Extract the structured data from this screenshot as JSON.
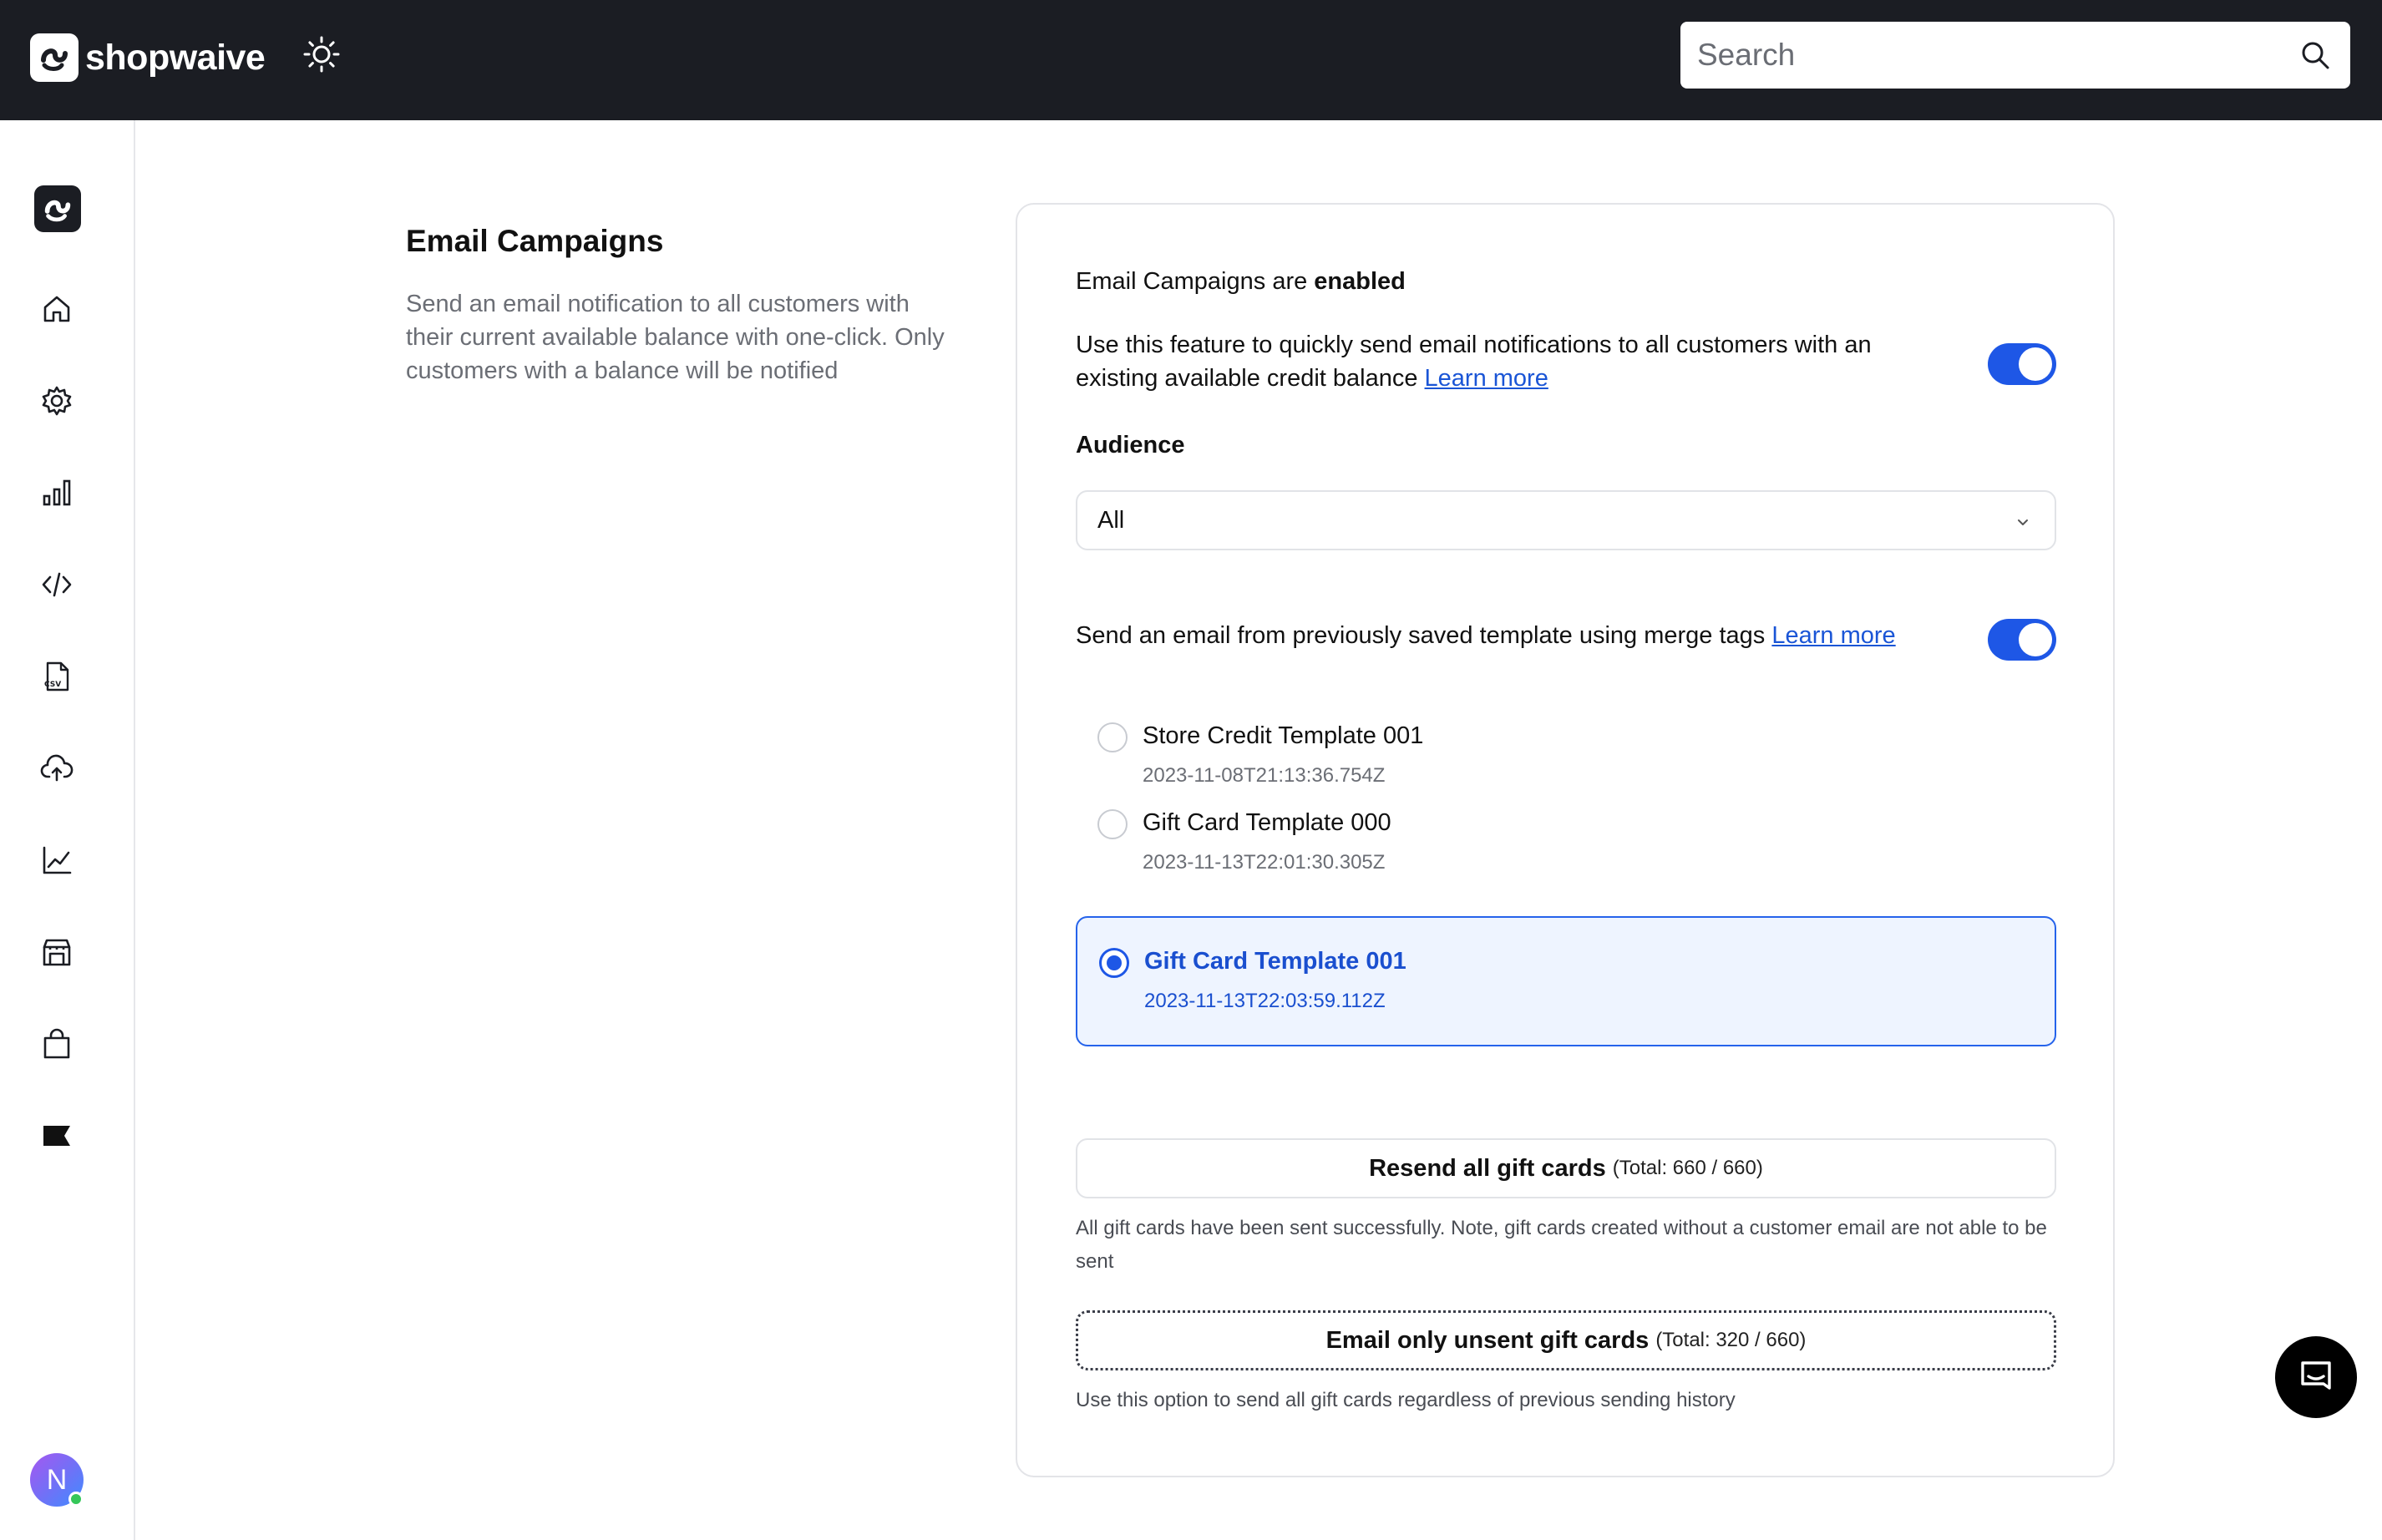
{
  "header": {
    "brand_name": "shopwaive",
    "search_placeholder": "Search"
  },
  "sidebar": {
    "items": [
      {
        "name": "home-icon"
      },
      {
        "name": "gear-icon"
      },
      {
        "name": "bar-chart-icon"
      },
      {
        "name": "code-icon"
      },
      {
        "name": "csv-file-icon"
      },
      {
        "name": "cloud-upload-icon"
      },
      {
        "name": "trend-chart-icon"
      },
      {
        "name": "storefront-icon"
      },
      {
        "name": "shopping-bag-icon"
      },
      {
        "name": "flag-icon"
      }
    ],
    "avatar_initial": "N"
  },
  "section": {
    "title": "Email Campaigns",
    "description": "Send an email notification to all customers with their current available balance with one-click. Only customers with a balance will be notified"
  },
  "card": {
    "status_prefix": "Email Campaigns are ",
    "status_value": "enabled",
    "feature_text": "Use this feature to quickly send email notifications to all customers with an existing available credit balance ",
    "feature_link": "Learn more",
    "feature_enabled": true,
    "audience_label": "Audience",
    "audience_value": "All",
    "template_text": "Send an email from previously saved template using merge tags ",
    "template_link": "Learn more",
    "template_enabled": true,
    "templates": [
      {
        "name": "Store Credit Template 001",
        "date": "2023-11-08T21:13:36.754Z",
        "selected": false
      },
      {
        "name": "Gift Card Template 000",
        "date": "2023-11-13T22:01:30.305Z",
        "selected": false
      },
      {
        "name": "Gift Card Template 001",
        "date": "2023-11-13T22:03:59.112Z",
        "selected": true
      }
    ],
    "resend_label": "Resend all gift cards",
    "resend_total": "(Total: 660 / 660)",
    "resend_help": "All gift cards have been sent successfully. Note, gift cards created without a customer email are not able to be sent",
    "unsent_label": "Email only unsent gift cards",
    "unsent_total": "(Total: 320 / 660)",
    "unsent_help": "Use this option to send all gift cards regardless of previous sending history"
  },
  "colors": {
    "topbar": "#1b1d23",
    "accent": "#1e57e6",
    "link": "#1a55d6"
  }
}
